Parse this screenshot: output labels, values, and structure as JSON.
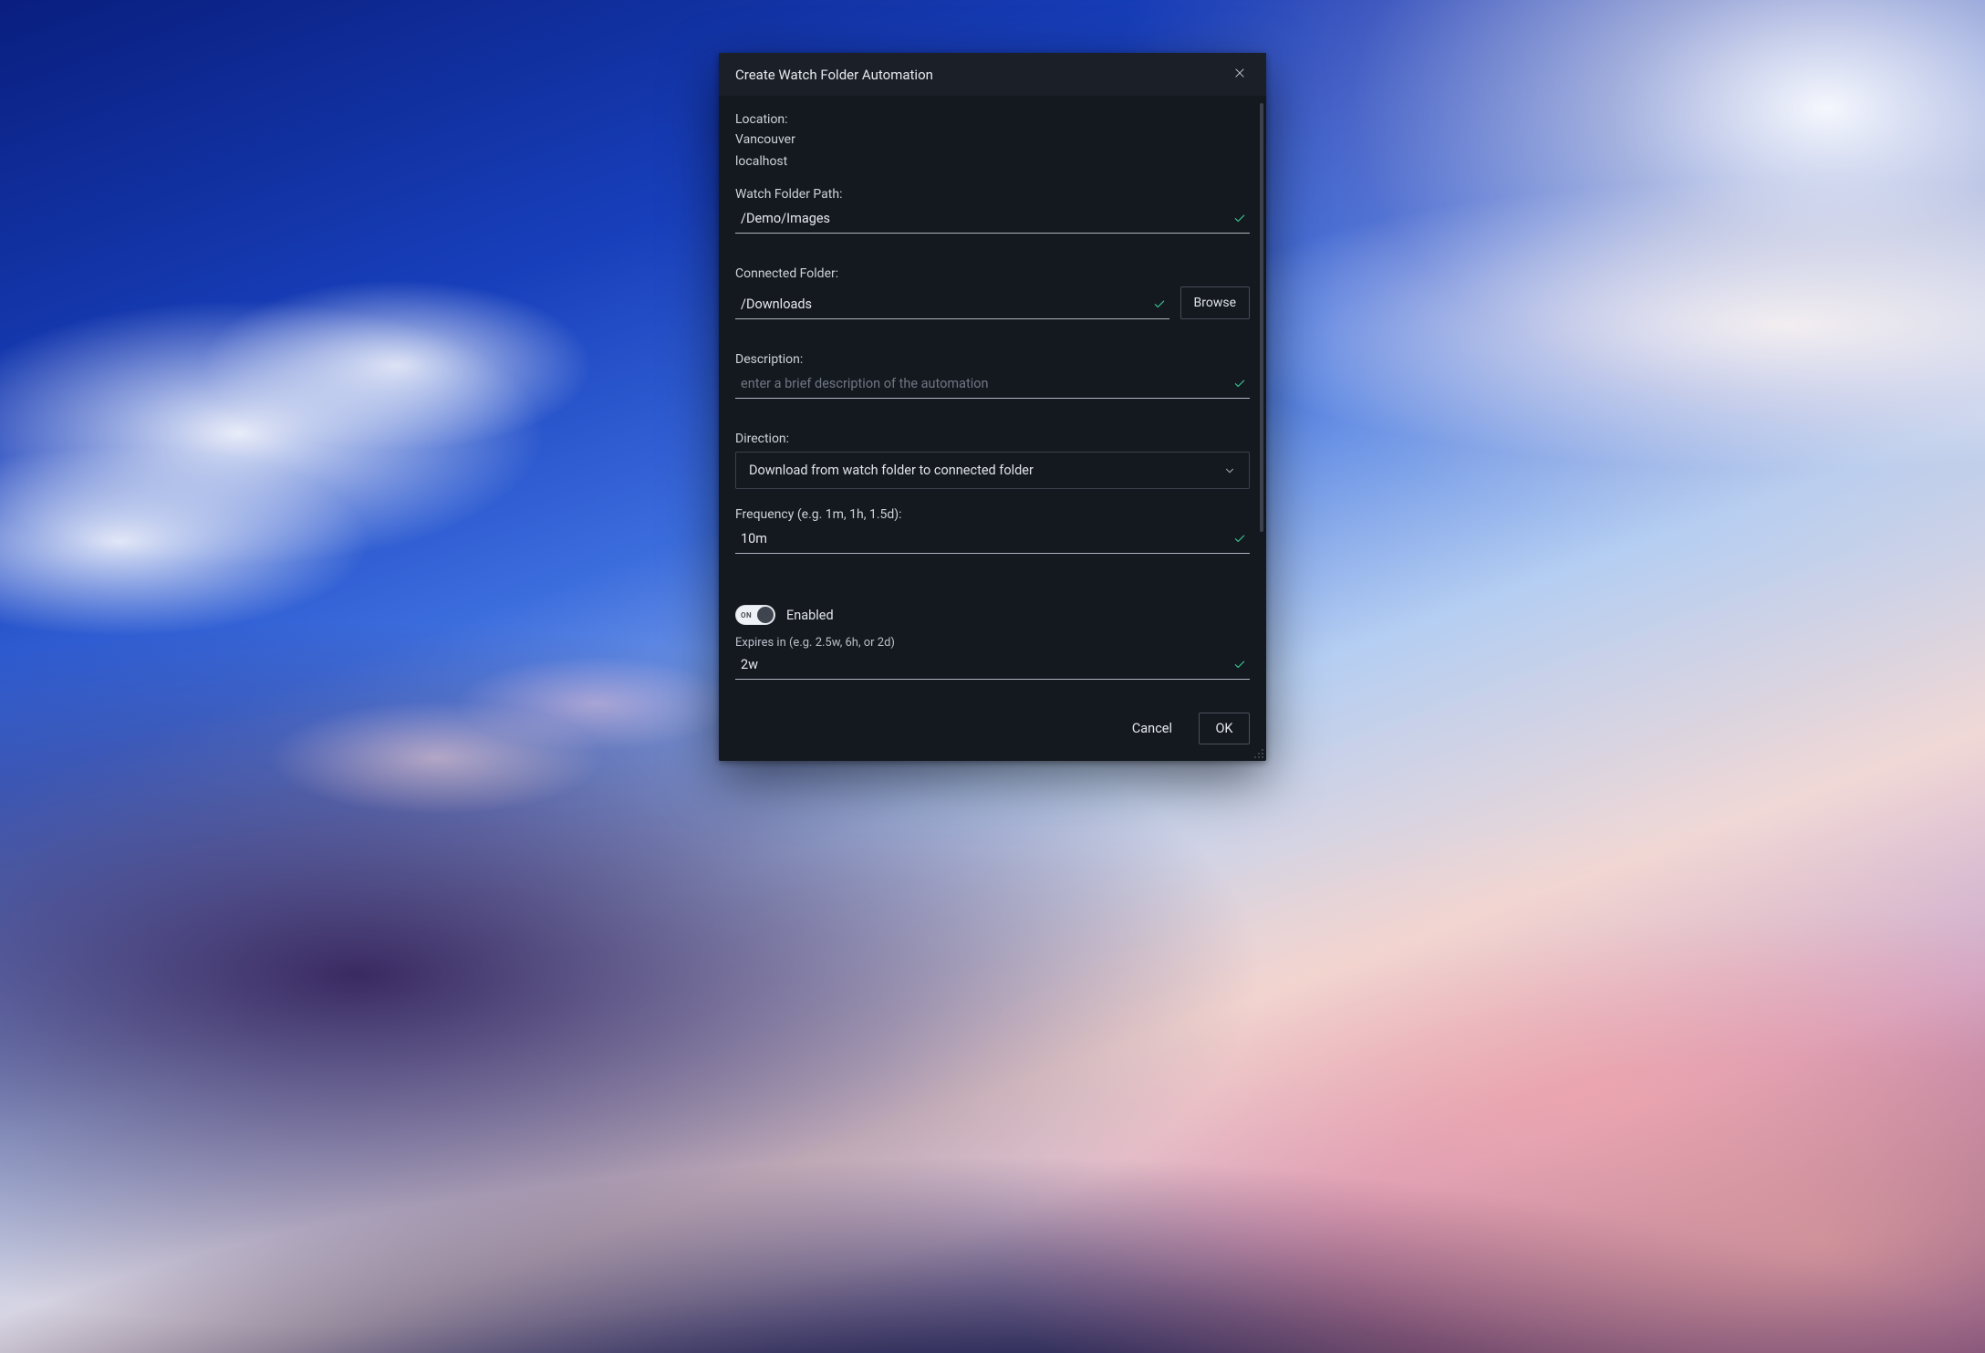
{
  "dialog": {
    "title": "Create Watch Folder Automation",
    "location_label": "Location:",
    "location_line1": "Vancouver",
    "location_line2": "localhost",
    "watch_folder_label": "Watch Folder Path:",
    "watch_folder_value": "/Demo/Images",
    "connected_folder_label": "Connected Folder:",
    "connected_folder_value": "/Downloads",
    "browse_label": "Browse",
    "description_label": "Description:",
    "description_value": "",
    "description_placeholder": "enter a brief description of the automation",
    "direction_label": "Direction:",
    "direction_value": "Download from watch folder to connected folder",
    "frequency_label": "Frequency (e.g. 1m, 1h, 1.5d):",
    "frequency_value": "10m",
    "enabled_toggle_text": "ON",
    "enabled_label": "Enabled",
    "enabled_state": true,
    "expires_label": "Expires in (e.g. 2.5w, 6h, or 2d)",
    "expires_value": "2w",
    "cancel_label": "Cancel",
    "ok_label": "OK"
  },
  "colors": {
    "dialog_bg": "#14181f",
    "header_bg": "#1a1f28",
    "text": "#d9dde3",
    "accent_check": "#36c98f",
    "border": "#3a414c"
  }
}
